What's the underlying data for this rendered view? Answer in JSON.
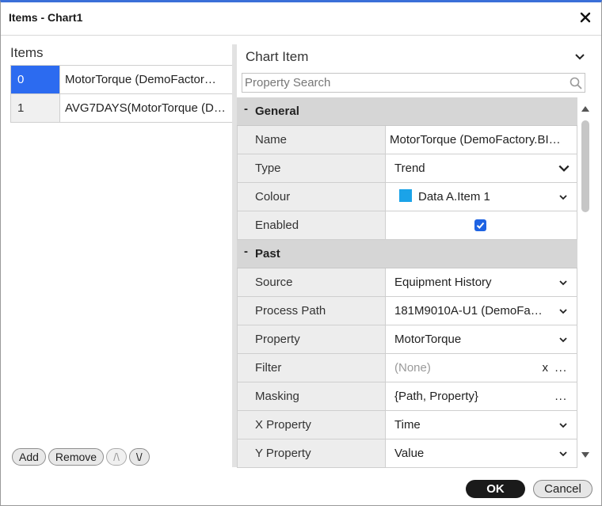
{
  "window": {
    "title": "Items - Chart1",
    "close_label": "✕"
  },
  "items_panel": {
    "label": "Items",
    "rows": [
      {
        "index": "0",
        "name": "MotorTorque (DemoFactor…",
        "selected": true
      },
      {
        "index": "1",
        "name": "AVG7DAYS(MotorTorque (D…",
        "selected": false
      }
    ],
    "buttons": {
      "add": "Add",
      "remove": "Remove",
      "up": "/\\",
      "down": "\\/"
    }
  },
  "chart_item_panel": {
    "label": "Chart Item",
    "search": {
      "placeholder": "Property Search",
      "value": ""
    },
    "sections": {
      "general": {
        "toggle": "-",
        "title": "General",
        "rows": {
          "name": {
            "label": "Name",
            "value": "MotorTorque (DemoFactory.BI…"
          },
          "type": {
            "label": "Type",
            "value": "Trend"
          },
          "colour": {
            "label": "Colour",
            "value": "Data A.Item 1",
            "swatch": "#1ba3e8"
          },
          "enabled": {
            "label": "Enabled",
            "checked": true
          }
        }
      },
      "past": {
        "toggle": "-",
        "title": "Past",
        "rows": {
          "source": {
            "label": "Source",
            "value": "Equipment History"
          },
          "process_path": {
            "label": "Process Path",
            "value": "181M9010A-U1 (DemoFa…"
          },
          "property": {
            "label": "Property",
            "value": "MotorTorque"
          },
          "filter": {
            "label": "Filter",
            "value": "(None)",
            "clear": "x",
            "more": "..."
          },
          "masking": {
            "label": "Masking",
            "value": "{Path, Property}",
            "more": "..."
          },
          "x_property": {
            "label": "X Property",
            "value": "Time"
          },
          "y_property": {
            "label": "Y Property",
            "value": "Value"
          }
        }
      }
    }
  },
  "footer": {
    "ok": "OK",
    "cancel": "Cancel"
  },
  "colors": {
    "accent": "#2c6bf0",
    "checkbox": "#1e63e3",
    "ok_bg": "#1a1a1a"
  }
}
